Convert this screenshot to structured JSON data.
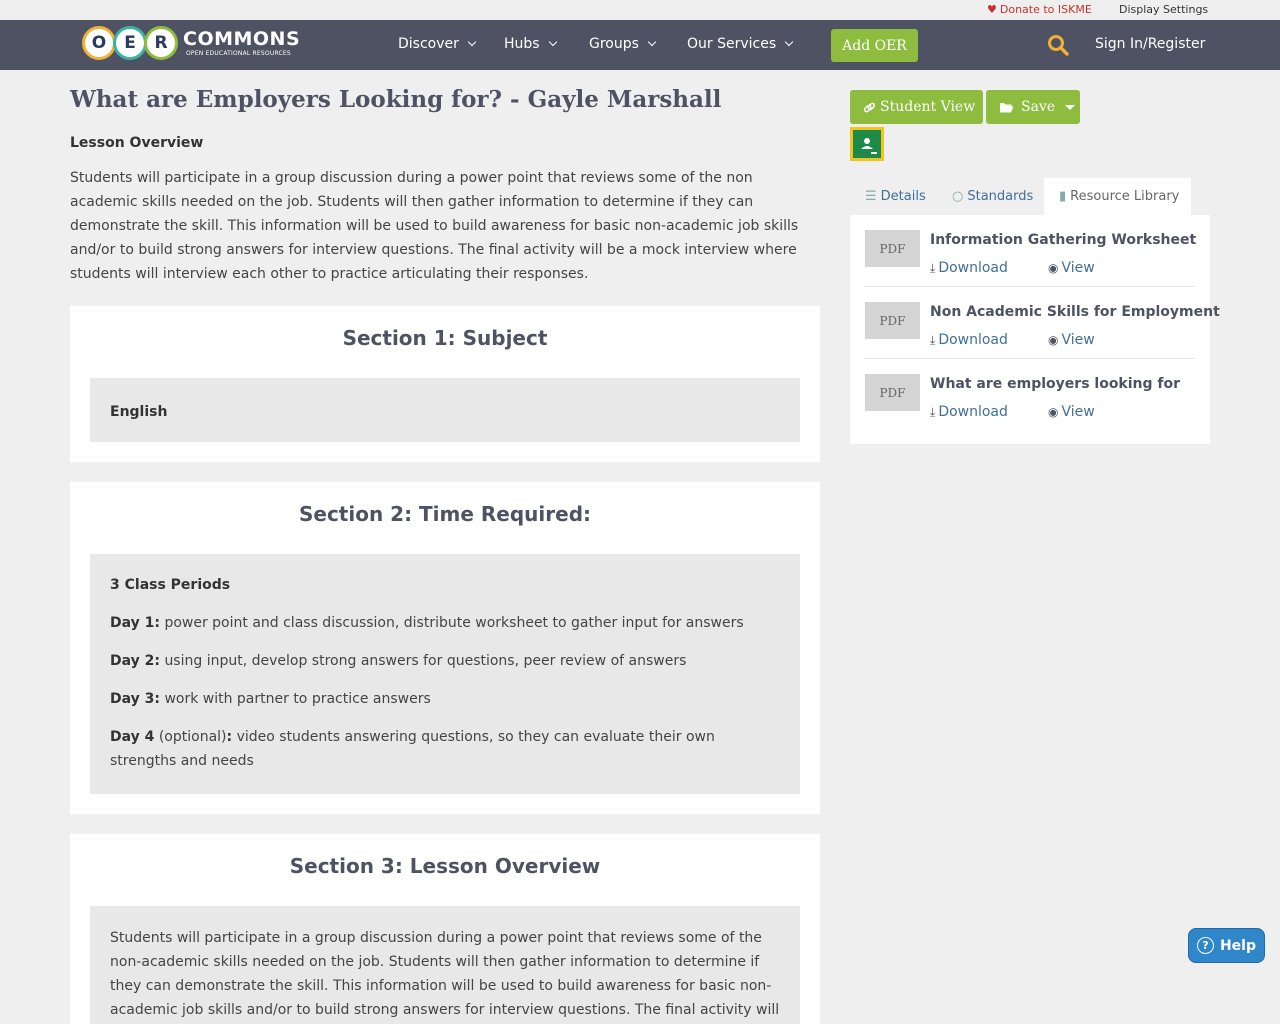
{
  "utility": {
    "donate": "Donate to ISKME",
    "display_settings": "Display Settings"
  },
  "logo": {
    "letters": [
      "O",
      "E",
      "R"
    ],
    "word": "COMMONS",
    "sub": "OPEN EDUCATIONAL RESOURCES"
  },
  "nav": {
    "items": [
      "Discover",
      "Hubs",
      "Groups",
      "Our Services"
    ],
    "add_oer": "Add OER",
    "sign_in": "Sign In/Register"
  },
  "main": {
    "title": "What are Employers Looking for? - Gayle Marshall",
    "overview_label": "Lesson Overview",
    "overview_text": "Students will participate in a group discussion during a power point that reviews some of the non academic skills needed on the job. Students will then gather information to determine if they can demonstrate the skill. This information will be used to build awareness for basic non-academic job skills and/or to build strong answers for interview questions. The final activity will be a mock interview where students will interview each other to practice articulating their responses."
  },
  "sections": {
    "s1": {
      "title": "Section 1: Subject",
      "value": "English"
    },
    "s2": {
      "title": "Section 2: Time Required:",
      "periods": "3 Class Periods",
      "day1_label": "Day 1:",
      "day1_text": "power point and class discussion, distribute worksheet to gather input for answers",
      "day2_label": "Day 2:",
      "day2_text": "using input, develop strong answers for questions, peer review of answers",
      "day3_label": "Day 3:",
      "day3_text": "work with partner to practice answers",
      "day4_label": "Day 4",
      "day4_note": "(optional)",
      "day4_colon": ":",
      "day4_text": "video students answering questions, so they can evaluate their own strengths and needs"
    },
    "s3": {
      "title": "Section 3: Lesson Overview",
      "text": "Students will participate in a group discussion during a power point that reviews some of the non-academic skills needed on the job.  Students will then gather information to determine if they can demonstrate the skill.  This information will be used to build awareness for basic non-academic job skills and/or to build strong answers for interview questions.  The final activity will be a mock interview"
    }
  },
  "sidebar": {
    "student_view": "Student View",
    "save": "Save",
    "tabs": {
      "details": "Details",
      "standards": "Standards",
      "library": "Resource Library"
    },
    "resources": [
      {
        "type": "PDF",
        "title": "Information Gathering Worksheet",
        "download": "Download",
        "view": "View"
      },
      {
        "type": "PDF",
        "title": "Non Academic Skills for Employment",
        "download": "Download",
        "view": "View"
      },
      {
        "type": "PDF",
        "title": "What are employers looking for",
        "download": "Download",
        "view": "View"
      }
    ]
  },
  "help": {
    "label": "Help"
  }
}
